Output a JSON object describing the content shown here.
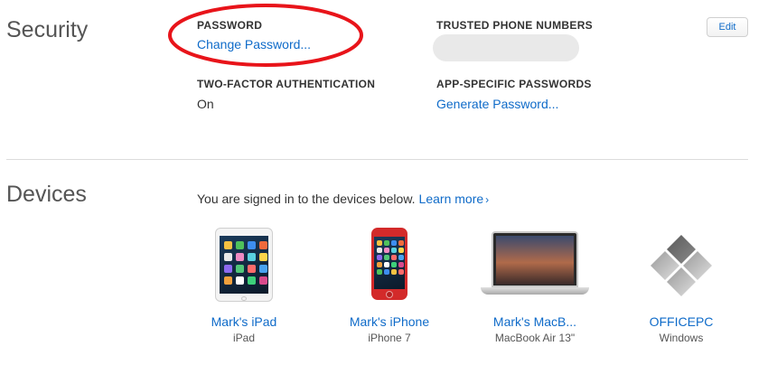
{
  "security": {
    "title": "Security",
    "password": {
      "label": "PASSWORD",
      "link": "Change Password..."
    },
    "two_factor": {
      "label": "TWO-FACTOR AUTHENTICATION",
      "value": "On"
    },
    "trusted_phones": {
      "label": "TRUSTED PHONE NUMBERS"
    },
    "app_passwords": {
      "label": "APP-SPECIFIC PASSWORDS",
      "link": "Generate Password..."
    },
    "edit_label": "Edit",
    "highlight_color": "#e8141a"
  },
  "devices": {
    "title": "Devices",
    "intro": "You are signed in to the devices below.",
    "learn_more": "Learn more",
    "items": [
      {
        "name": "Mark's iPad",
        "model": "iPad",
        "icon": "ipad-icon"
      },
      {
        "name": "Mark's iPhone",
        "model": "iPhone 7",
        "icon": "iphone-icon"
      },
      {
        "name": "Mark's MacB...",
        "model": "MacBook Air 13\"",
        "icon": "macbook-icon"
      },
      {
        "name": "OFFICEPC",
        "model": "Windows",
        "icon": "windows-pc-icon"
      }
    ]
  },
  "colors": {
    "link": "#0f6bc9",
    "accent_red": "#e8141a"
  }
}
